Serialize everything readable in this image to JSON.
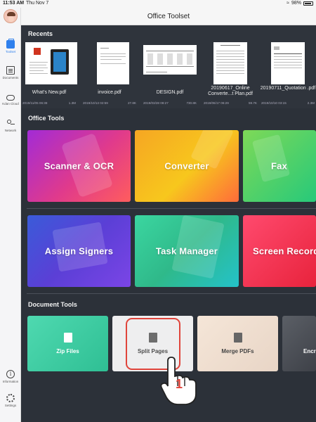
{
  "status_bar": {
    "time": "11:53 AM",
    "date": "Thu Nov 7",
    "battery": "98%"
  },
  "header": {
    "title": "Office Toolset"
  },
  "sidebar": {
    "items": [
      {
        "label": "Toolset",
        "icon": "toolset-icon",
        "active": true
      },
      {
        "label": "Documents",
        "icon": "documents-icon"
      },
      {
        "label": "Kdan Cloud",
        "icon": "cloud-icon"
      },
      {
        "label": "Network",
        "icon": "network-icon"
      },
      {
        "label": "Information",
        "icon": "info-icon"
      },
      {
        "label": "Settings",
        "icon": "settings-icon"
      }
    ]
  },
  "recents": {
    "title": "Recents",
    "files": [
      {
        "name": "What's New.pdf",
        "date": "2019/11/05 06:38",
        "size": "1.3M"
      },
      {
        "name": "invoice.pdf",
        "date": "2019/10/13 02:59",
        "size": "27.8K"
      },
      {
        "name": "DESIGN.pdf",
        "date": "2019/03/28 08:27",
        "size": "730.8K"
      },
      {
        "name": "20190617_Online Converte...t Plan.pdf",
        "date": "2019/06/17 06:29",
        "size": "59.7K"
      },
      {
        "name": "20190711_Quotation .pdf",
        "date": "2019/10/10 03:15",
        "size": "2.3M"
      }
    ]
  },
  "office_tools": {
    "title": "Office Tools",
    "tiles": [
      {
        "label": "Scanner & OCR"
      },
      {
        "label": "Converter"
      },
      {
        "label": "Fax"
      },
      {
        "label": "Assign Signers"
      },
      {
        "label": "Task Manager"
      },
      {
        "label": "Screen Recorder"
      }
    ]
  },
  "document_tools": {
    "title": "Document Tools",
    "tiles": [
      {
        "label": "Zip Files"
      },
      {
        "label": "Split Pages"
      },
      {
        "label": "Merge PDFs"
      },
      {
        "label": "Encrypt"
      }
    ]
  },
  "annotation": {
    "step": "1"
  },
  "colors": {
    "accent": "#2f80ed",
    "highlight": "#e0443b"
  }
}
